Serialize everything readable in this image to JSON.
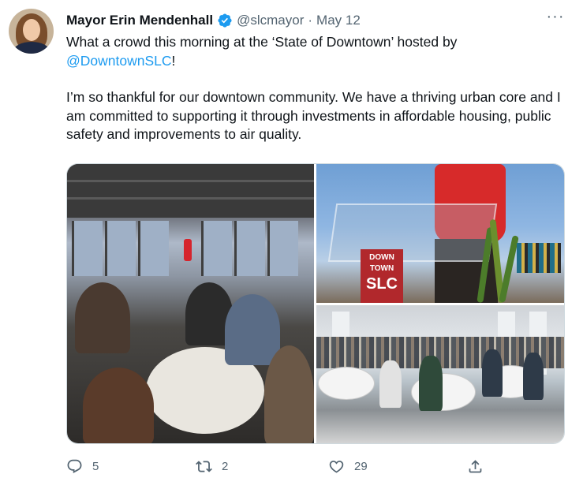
{
  "tweet": {
    "author_name": "Mayor Erin Mendenhall",
    "handle": "@slcmayor",
    "separator": "·",
    "date": "May 12",
    "more_label": "···",
    "text_line1_before": "What a crowd this morning at the ‘State of Downtown’ hosted by ",
    "mention": "@DowntownSLC",
    "text_line1_after": "!",
    "paragraph2": "I’m so thankful for our downtown community. We have a thriving urban core and I am committed to supporting it through investments in affordable housing, public safety and improvements to air quality."
  },
  "media": {
    "photos": [
      {
        "name": "Event room with speaker and audience at round tables"
      },
      {
        "name": "Speaker at glass podium with DOWNTOWN SLC sign"
      },
      {
        "name": "Wide view of audience seated at round tables"
      }
    ],
    "sign_line1": "DOWN",
    "sign_line2": "TOWN",
    "sign_line3": "SLC"
  },
  "actions": {
    "reply_count": "5",
    "retweet_count": "2",
    "like_count": "29",
    "icons": [
      "reply-icon",
      "retweet-icon",
      "like-icon",
      "share-icon"
    ]
  },
  "colors": {
    "accent": "#1d9bf0",
    "text": "#0f1419",
    "secondary": "#536471",
    "border": "#cfd9de"
  }
}
